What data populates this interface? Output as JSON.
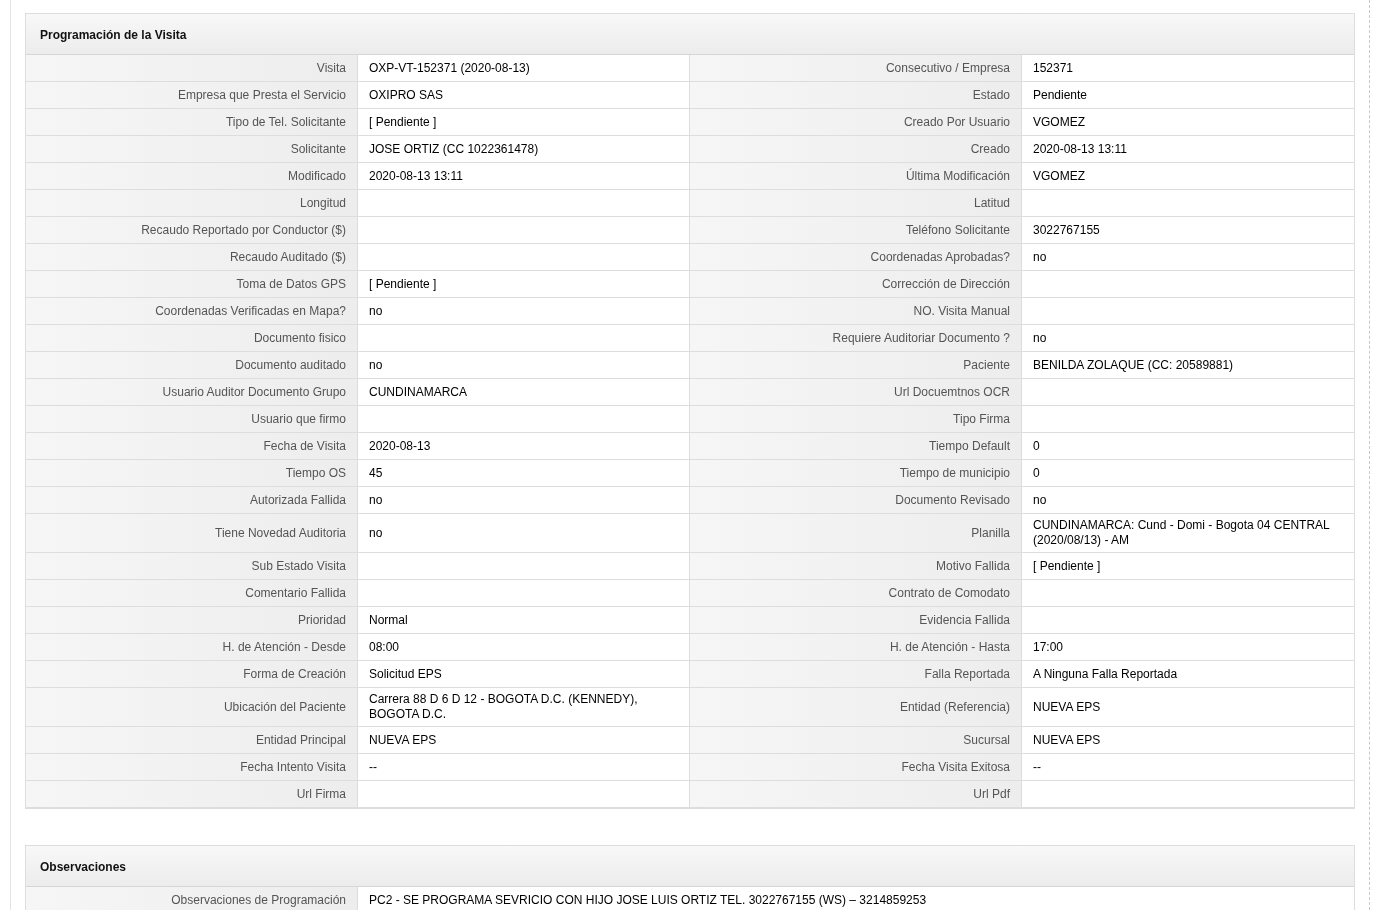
{
  "sections": [
    {
      "title": "Programación de la Visita",
      "rows": [
        [
          {
            "label": "Visita",
            "value": "OXP-VT-152371 (2020-08-13)"
          },
          {
            "label": "Consecutivo / Empresa",
            "value": "152371"
          }
        ],
        [
          {
            "label": "Empresa que Presta el Servicio",
            "value": "OXIPRO SAS"
          },
          {
            "label": "Estado",
            "value": "Pendiente"
          }
        ],
        [
          {
            "label": "Tipo de Tel. Solicitante",
            "value": "[ Pendiente ]"
          },
          {
            "label": "Creado Por Usuario",
            "value": "VGOMEZ"
          }
        ],
        [
          {
            "label": "Solicitante",
            "value": "JOSE ORTIZ (CC 1022361478)"
          },
          {
            "label": "Creado",
            "value": "2020-08-13 13:11"
          }
        ],
        [
          {
            "label": "Modificado",
            "value": "2020-08-13 13:11"
          },
          {
            "label": "Última Modificación",
            "value": "VGOMEZ"
          }
        ],
        [
          {
            "label": "Longitud"
          },
          {
            "label": "Latitud"
          }
        ],
        [
          {
            "label": "Recaudo Reportado por Conductor ($)"
          },
          {
            "label": "Teléfono Solicitante",
            "value": "3022767155"
          }
        ],
        [
          {
            "label": "Recaudo Auditado ($)"
          },
          {
            "label": "Coordenadas Aprobadas?",
            "value": "no"
          }
        ],
        [
          {
            "label": "Toma de Datos GPS",
            "value": "[ Pendiente ]"
          },
          {
            "label": "Corrección de Dirección"
          }
        ],
        [
          {
            "label": "Coordenadas Verificadas en Mapa?",
            "value": "no"
          },
          {
            "label": "NO. Visita Manual"
          }
        ],
        [
          {
            "label": "Documento fisico"
          },
          {
            "label": "Requiere Auditoriar Documento ?",
            "value": "no"
          }
        ],
        [
          {
            "label": "Documento auditado",
            "value": "no"
          },
          {
            "label": "Paciente",
            "value": "BENILDA ZOLAQUE (CC: 20589881)"
          }
        ],
        [
          {
            "label": "Usuario Auditor Documento Grupo",
            "value": "CUNDINAMARCA"
          },
          {
            "label": "Url Docuemtnos OCR"
          }
        ],
        [
          {
            "label": "Usuario que firmo"
          },
          {
            "label": "Tipo Firma"
          }
        ],
        [
          {
            "label": "Fecha de Visita",
            "value": "2020-08-13"
          },
          {
            "label": "Tiempo Default",
            "value": "0"
          }
        ],
        [
          {
            "label": "Tiempo OS",
            "value": "45"
          },
          {
            "label": "Tiempo de municipio",
            "value": "0"
          }
        ],
        [
          {
            "label": "Autorizada Fallida",
            "value": "no"
          },
          {
            "label": "Documento Revisado",
            "value": "no"
          }
        ],
        [
          {
            "label": "Tiene Novedad Auditoria",
            "value": "no"
          },
          {
            "label": "Planilla",
            "value": "CUNDINAMARCA: Cund - Domi - Bogota 04 CENTRAL (2020/08/13) - AM"
          }
        ],
        [
          {
            "label": "Sub Estado Visita"
          },
          {
            "label": "Motivo Fallida",
            "value": "[ Pendiente ]"
          }
        ],
        [
          {
            "label": "Comentario Fallida"
          },
          {
            "label": "Contrato de Comodato"
          }
        ],
        [
          {
            "label": "Prioridad",
            "value": "Normal"
          },
          {
            "label": "Evidencia Fallida"
          }
        ],
        [
          {
            "label": "H. de Atención - Desde",
            "value": "08:00"
          },
          {
            "label": "H. de Atención - Hasta",
            "value": "17:00"
          }
        ],
        [
          {
            "label": "Forma de Creación",
            "value": "Solicitud EPS"
          },
          {
            "label": "Falla Reportada",
            "value": "A Ninguna Falla Reportada"
          }
        ],
        [
          {
            "label": "Ubicación del Paciente",
            "value": "Carrera 88 D 6 D 12 - BOGOTA D.C. (KENNEDY), BOGOTA D.C."
          },
          {
            "label": "Entidad (Referencia)",
            "value": "NUEVA EPS"
          }
        ],
        [
          {
            "label": "Entidad Principal",
            "value": "NUEVA EPS"
          },
          {
            "label": "Sucursal",
            "value": "NUEVA EPS"
          }
        ],
        [
          {
            "label": "Fecha Intento Visita",
            "value": "--"
          },
          {
            "label": "Fecha Visita Exitosa",
            "value": "--"
          }
        ],
        [
          {
            "label": "Url Firma"
          },
          {
            "label": "Url Pdf"
          }
        ]
      ]
    },
    {
      "title": "Observaciones",
      "rows": [
        [
          {
            "label": "Observaciones de Programación",
            "value": "PC2 - SE PROGRAMA SEVRICIO CON HIJO JOSE LUIS ORTIZ TEL. 3022767155 (WS) – 3214859253"
          }
        ]
      ]
    }
  ]
}
